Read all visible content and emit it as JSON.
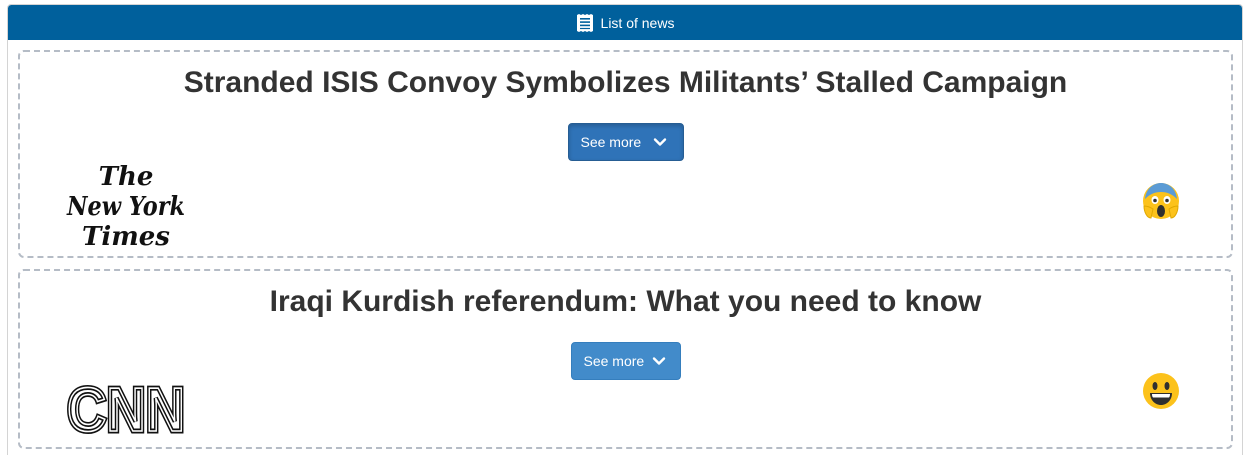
{
  "header": {
    "title": "List of news",
    "icon": "list-icon"
  },
  "news": [
    {
      "title": "Stranded ISIS Convoy Symbolizes Militants’ Stalled Campaign",
      "see_more_label": "See more",
      "source_logo": "nytimes-logo",
      "source_name": "The New York Times",
      "reaction": "screaming-face-emoji"
    },
    {
      "title": "Iraqi Kurdish referendum: What you need to know",
      "see_more_label": "See more",
      "source_logo": "cnn-logo",
      "source_name": "CNN",
      "reaction": "grinning-face-emoji"
    }
  ],
  "colors": {
    "header_bg": "#00609c",
    "button_active": "#2f73b8",
    "button": "#428bca",
    "card_border": "#b5bcc6"
  }
}
